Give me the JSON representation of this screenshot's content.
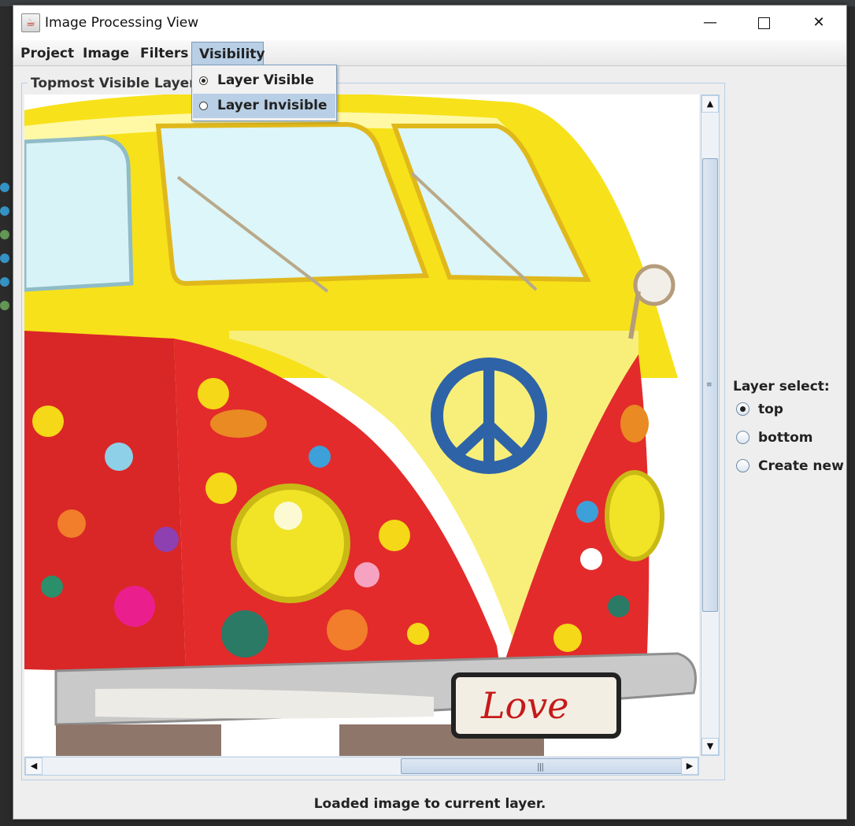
{
  "window": {
    "title": "Image Processing View",
    "minimize_glyph": "—",
    "close_glyph": "✕"
  },
  "menubar": {
    "items": [
      {
        "label": "Project"
      },
      {
        "label": "Image"
      },
      {
        "label": "Filters"
      },
      {
        "label": "Visibility",
        "open": true
      }
    ]
  },
  "visibility_menu": {
    "items": [
      {
        "label": "Layer Visible",
        "selected": true
      },
      {
        "label": "Layer Invisible",
        "selected": false,
        "highlighted": true
      }
    ]
  },
  "layer_panel": {
    "title": "Topmost Visible Layer",
    "image_text": "Love"
  },
  "layer_select": {
    "title": "Layer select:",
    "options": [
      {
        "label": "top",
        "selected": true
      },
      {
        "label": "bottom",
        "selected": false
      },
      {
        "label": "Create new",
        "selected": false
      }
    ]
  },
  "status": {
    "text": "Loaded image to current layer."
  },
  "colors": {
    "menu_highlight": "#b8cfe5",
    "bus_yellow": "#f7e11a",
    "bus_red": "#d92727",
    "window_bg": "#eeeeee"
  }
}
